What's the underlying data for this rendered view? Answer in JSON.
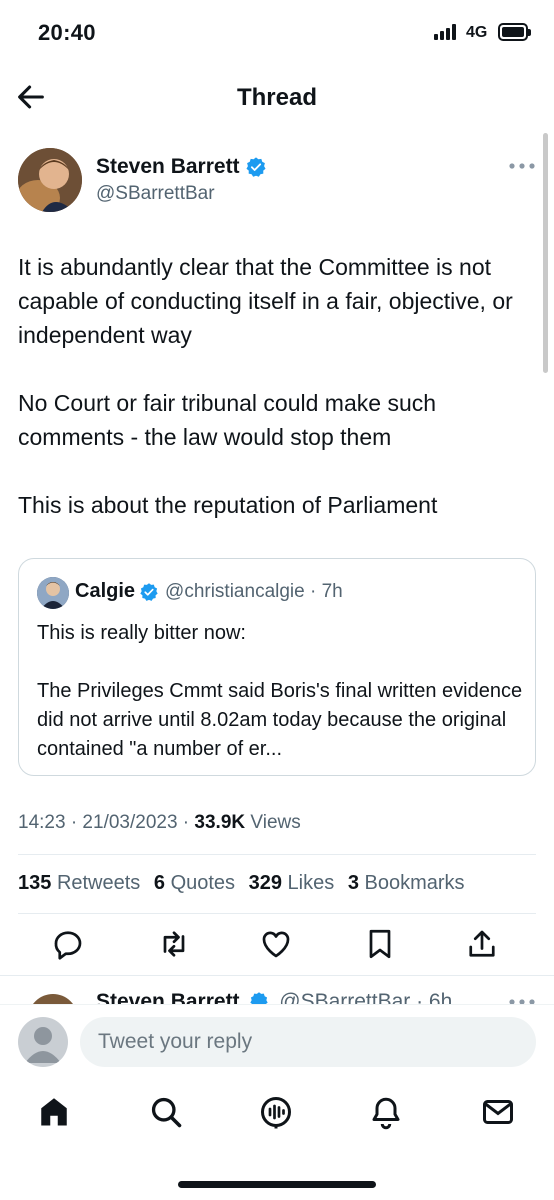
{
  "status_bar": {
    "time": "20:40",
    "network": "4G",
    "battery_level": 1.0
  },
  "header": {
    "title": "Thread"
  },
  "tweet": {
    "author_name": "Steven Barrett",
    "author_handle": "@SBarrettBar",
    "paragraphs": [
      "It is abundantly clear that the Committee is not capable of conducting itself in a fair, objective, or independent way",
      "No Court or fair tribunal could make such comments - the law would stop them",
      "This is about the reputation of Parliament"
    ],
    "quote": {
      "author_name": "Calgie",
      "handle_time": "@christiancalgie · 7h",
      "paragraphs": [
        "This is really bitter now:",
        "The Privileges Cmmt said Boris's final written evidence did not arrive until 8.02am today because the original contained \"a number of er..."
      ]
    },
    "timestamp": "14:23 · 21/03/2023 · ",
    "views_count": "33.9K",
    "views_label": " Views",
    "stats": [
      {
        "count": "135",
        "label": "Retweets"
      },
      {
        "count": "6",
        "label": "Quotes"
      },
      {
        "count": "329",
        "label": "Likes"
      },
      {
        "count": "3",
        "label": "Bookmarks"
      }
    ]
  },
  "next_tweet": {
    "author_name": "Steven Barrett",
    "meta": "@SBarrettBar · 6h"
  },
  "reply": {
    "placeholder": "Tweet your reply"
  },
  "icons": {
    "back": "arrow-left-icon",
    "verified": "verified-badge-icon",
    "more": "more-dots-icon",
    "actions": [
      "reply-icon",
      "retweet-icon",
      "like-icon",
      "bookmark-icon",
      "share-icon"
    ],
    "tabs": [
      "home-icon",
      "search-icon",
      "spaces-icon",
      "notifications-icon",
      "messages-icon"
    ]
  },
  "colors": {
    "text": "#0f1419",
    "secondary": "#536471",
    "verified": "#1d9bf0",
    "border": "#cfd9de"
  }
}
